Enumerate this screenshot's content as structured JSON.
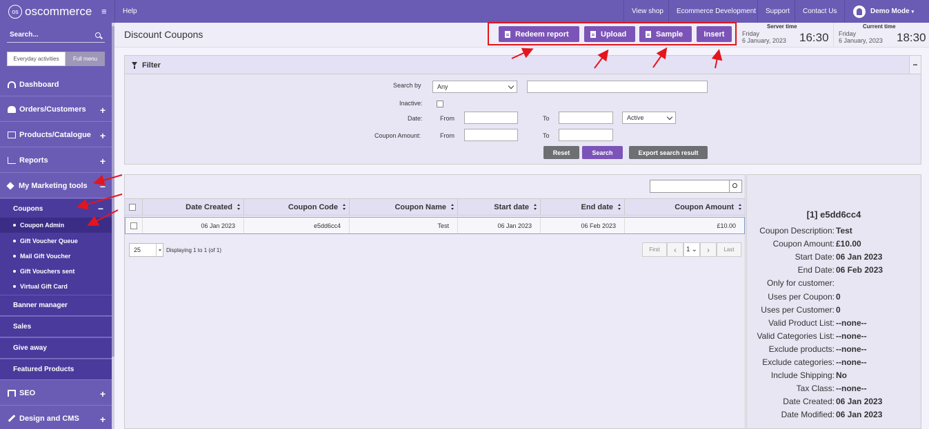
{
  "topbar": {
    "logo": "oscommerce",
    "help": "Help",
    "view_shop": "View shop",
    "ecommerce_dev": "Ecommerce Development",
    "support": "Support",
    "contact_us": "Contact Us",
    "demo_mode": "Demo Mode"
  },
  "sidebar": {
    "search_label": "Search...",
    "tab_everyday": "Everyday activities",
    "tab_full": "Full menu",
    "items": {
      "dashboard": "Dashboard",
      "orders": "Orders/Customers",
      "products": "Products/Catalogue",
      "reports": "Reports",
      "marketing": "My Marketing tools",
      "coupons": "Coupons",
      "coupon_admin": "Coupon Admin",
      "gv_queue": "Gift Voucher Queue",
      "mail_gv": "Mail Gift Voucher",
      "gv_sent": "Gift Vouchers sent",
      "virtual_gift": "Virtual Gift Card",
      "banner": "Banner manager",
      "sales": "Sales",
      "give_away": "Give away",
      "featured": "Featured Products",
      "seo": "SEO",
      "design": "Design and CMS"
    }
  },
  "header": {
    "title": "Discount Coupons",
    "buttons": {
      "redeem": "Redeem report",
      "upload": "Upload",
      "sample": "Sample",
      "insert": "Insert"
    },
    "server_time": {
      "label": "Server time",
      "day": "Friday",
      "date": "6 January, 2023",
      "time": "16:30"
    },
    "current_time": {
      "label": "Current time",
      "day": "Friday",
      "date": "6 January, 2023",
      "time": "18:30"
    }
  },
  "filter": {
    "title": "Filter",
    "search_by_label": "Search by",
    "search_by_value": "Any",
    "inactive_label": "Inactive:",
    "date_label": "Date:",
    "from_label": "From",
    "to_label": "To",
    "status_value": "Active",
    "amount_label": "Coupon Amount:",
    "reset": "Reset",
    "search": "Search",
    "export": "Export search result"
  },
  "table": {
    "headers": [
      "Date Created",
      "Coupon Code",
      "Coupon Name",
      "Start date",
      "End date",
      "Coupon Amount"
    ],
    "rows": [
      {
        "date_created": "06 Jan 2023",
        "code": "e5dd6cc4",
        "name": "Test",
        "start": "06 Jan 2023",
        "end": "06 Feb 2023",
        "amount": "£10.00"
      }
    ],
    "page_size": "25",
    "displaying": "Displaying 1 to 1 (of 1)",
    "pager": {
      "first": "First",
      "page": "1",
      "last": "Last"
    }
  },
  "details": {
    "title": "[1] e5dd6cc4",
    "rows": [
      {
        "k": "Coupon Description:",
        "v": "Test"
      },
      {
        "k": "Coupon Amount:",
        "v": "£10.00"
      },
      {
        "k": "Start Date:",
        "v": "06 Jan 2023"
      },
      {
        "k": "End Date:",
        "v": "06 Feb 2023"
      },
      {
        "k": "Only for customer:",
        "v": ""
      },
      {
        "k": "Uses per Coupon:",
        "v": "0"
      },
      {
        "k": "Uses per Customer:",
        "v": "0"
      },
      {
        "k": "Valid Product List:",
        "v": "--none--"
      },
      {
        "k": "Valid Categories List:",
        "v": "--none--"
      },
      {
        "k": "Exclude products:",
        "v": "--none--"
      },
      {
        "k": "Exclude categories:",
        "v": "--none--"
      },
      {
        "k": "Include Shipping:",
        "v": "No"
      },
      {
        "k": "Tax Class:",
        "v": "--none--"
      },
      {
        "k": "Date Created:",
        "v": "06 Jan 2023"
      },
      {
        "k": "Date Modified:",
        "v": "06 Jan 2023"
      }
    ]
  },
  "colors": {
    "brand": "#6a5bb4",
    "button": "#7c54b8",
    "annotation": "#e4151c"
  }
}
